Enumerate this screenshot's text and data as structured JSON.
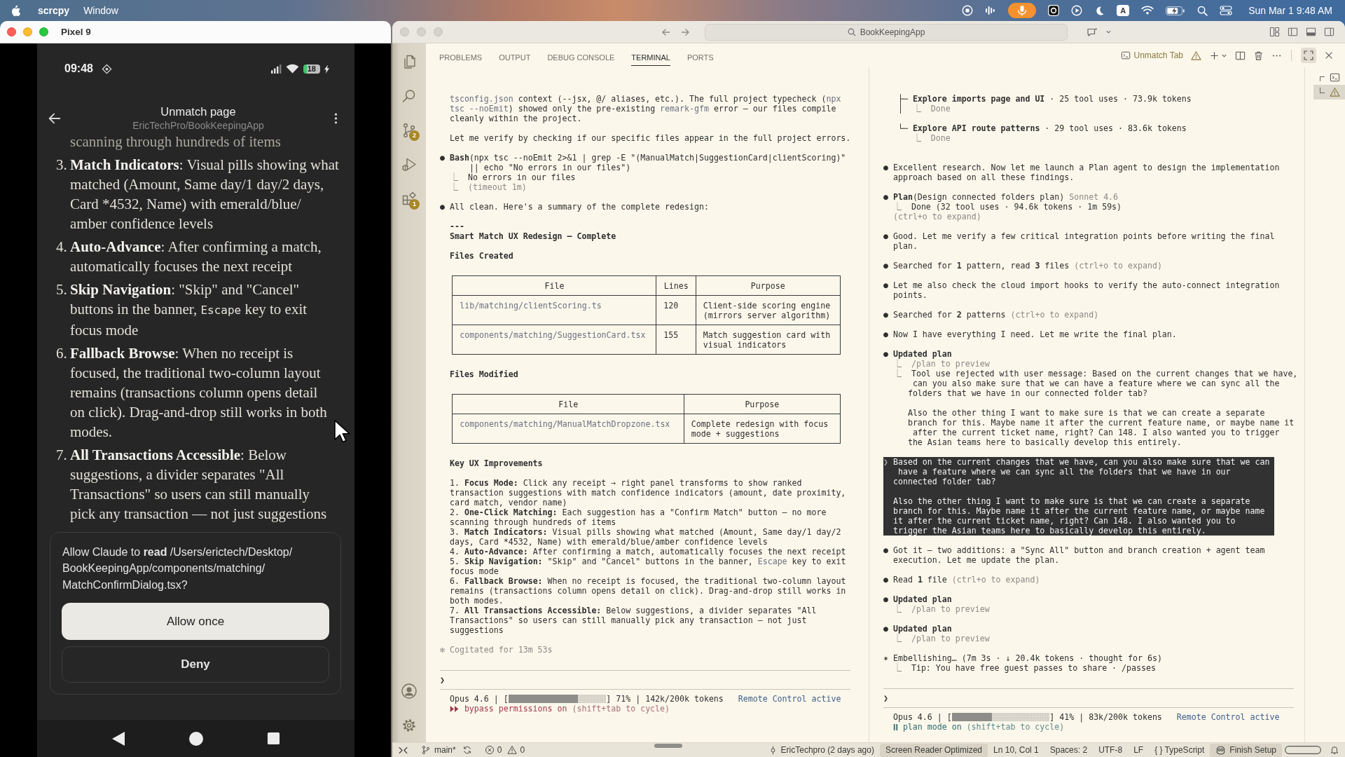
{
  "menu_bar": {
    "app_name": "scrcpy",
    "menus": [
      "Window"
    ],
    "input_source": "A",
    "clock": "Sun Mar 1 9:48 AM"
  },
  "phone_window": {
    "title": "Pixel 9",
    "status_bar": {
      "time": "09:48",
      "battery": "18"
    },
    "header": {
      "title": "Unmatch page",
      "subtitle": "EricTechPro/BookKeepingApp"
    },
    "cut_off_line": "scanning through hundreds of items",
    "items": [
      {
        "number": "3.",
        "parts": [
          {
            "text": "**Match Indicators**: Visual pills showing what\nmatched (Amount, Same day/1 day/2 days,\nCard ",
            "kind": "plain"
          },
          {
            "text": "*4532, Name) with emerald/blue/\namber confidence levels",
            "kind": "plain"
          }
        ]
      },
      {
        "number": "4.",
        "parts": [
          {
            "text": "**Auto-Advance**: After confirming a match,\nautomatically focuses the next receipt",
            "kind": "plain"
          }
        ]
      },
      {
        "number": "5.",
        "parts": [
          {
            "text": "**Skip Navigation**: \"Skip\" and \"Cancel\"\nbuttons in the banner, ",
            "kind": "plain"
          },
          {
            "text": "Escape",
            "kind": "code"
          },
          {
            "text": " key to exit\nfocus mode",
            "kind": "plain"
          }
        ]
      },
      {
        "number": "6.",
        "parts": [
          {
            "text": "**Fallback Browse**: When no receipt is\nfocused, the traditional two-column layout\nremains (transactions column opens detail\non click). Drag-and-drop still works in both\nmodes.",
            "kind": "plain"
          }
        ]
      },
      {
        "number": "7.",
        "parts": [
          {
            "text": "**All Transactions Accessible**: Below\nsuggestions, a divider separates \"All\nTransactions\" so users can still manually\npick any transaction — not just suggestions",
            "kind": "plain"
          }
        ]
      }
    ],
    "permission": {
      "text": "Allow Claude to **read** /Users/erictech/Desktop/\nBookKeepingApp/components/matching/\nMatchConfirmDialog.tsx?",
      "buttons": [
        {
          "label": "Allow once",
          "kind": "primary"
        },
        {
          "label": "Deny",
          "kind": "secondary"
        }
      ]
    }
  },
  "editor_window": {
    "search": "BookKeepingApp",
    "source_control_badge": "2",
    "extensions_badge": "1",
    "panel_tabs": [
      {
        "label": "PROBLEMS",
        "selected": false
      },
      {
        "label": "OUTPUT",
        "selected": false
      },
      {
        "label": "DEBUG CONSOLE",
        "selected": false
      },
      {
        "label": "TERMINAL",
        "selected": true
      },
      {
        "label": "PORTS",
        "selected": false
      }
    ],
    "terminal_name": "Unmatch Tab",
    "terminals": [
      {
        "sections": [
          {
            "items": [
              {
                "kind": "text",
                "parts": [
                  {
                    "text": "  tsconfig.json",
                    "kind": "code"
                  },
                  {
                    "text": " context (--jsx, @/ aliases, etc.). The full project typecheck (",
                    "kind": "plain"
                  },
                  {
                    "text": "npx\n  tsc --noEmit",
                    "kind": "code"
                  },
                  {
                    "text": ") showed only the pre-existing ",
                    "kind": "plain"
                  },
                  {
                    "text": "remark-gfm",
                    "kind": "code"
                  },
                  {
                    "text": " error — our files compile\n  cleanly within the project.",
                    "kind": "plain"
                  }
                ]
              }
            ]
          },
          {
            "items": [
              {
                "kind": "text",
                "parts": [
                  {
                    "text": "  Let me verify by checking if our specific files appear in the full project errors.",
                    "kind": "plain"
                  }
                ]
              }
            ]
          },
          {
            "items": [
              {
                "kind": "text",
                "parts": [
                  {
                    "text": "● **Bash**(npx tsc --noEmit 2>&1 | grep -E \"(ManualMatch|SuggestionCard|clientScoring)\"\n      || echo \"No errors in our files\")\n  ",
                    "kind": "plain"
                  },
                  {
                    "text": "⎿",
                    "kind": "dim"
                  },
                  {
                    "text": "  No errors in our files\n  ",
                    "kind": "plain"
                  },
                  {
                    "text": "⎿  (timeout 1m)",
                    "kind": "dim"
                  }
                ]
              }
            ]
          },
          {
            "items": [
              {
                "kind": "text",
                "parts": [
                  {
                    "text": "● All clean. Here's a summary of the complete redesign:",
                    "kind": "plain"
                  }
                ]
              }
            ]
          },
          {
            "items": [
              {
                "kind": "heading",
                "parts": [
                  {
                    "text": "  ---\n  Smart Match UX Redesign — Complete",
                    "kind": "plain"
                  }
                ]
              }
            ]
          },
          {
            "items": [
              {
                "kind": "heading",
                "parts": [
                  {
                    "text": "  Files Created",
                    "kind": "plain"
                  }
                ]
              }
            ]
          },
          {
            "items": [
              {
                "kind": "table",
                "columns": [
                  {
                    "label": "File",
                    "kind": "code"
                  },
                  {
                    "label": "Lines",
                    "kind": "plain"
                  },
                  {
                    "label": "Purpose",
                    "kind": "plain"
                  }
                ],
                "rows": [
                  [
                    "lib/matching/clientScoring.ts",
                    "120",
                    "Client-side scoring engine\n(mirrors server algorithm)"
                  ],
                  [
                    "components/matching/SuggestionCard.tsx",
                    "155",
                    "Match suggestion card with\nvisual indicators"
                  ]
                ]
              }
            ]
          },
          {
            "items": [
              {
                "kind": "heading",
                "parts": [
                  {
                    "text": "  Files Modified",
                    "kind": "plain"
                  }
                ]
              }
            ]
          },
          {
            "items": [
              {
                "kind": "table",
                "columns": [
                  {
                    "label": "File",
                    "kind": "code"
                  },
                  {
                    "label": "Purpose",
                    "kind": "plain"
                  }
                ],
                "rows": [
                  [
                    "components/matching/ManualMatchDropzone.tsx",
                    "Complete redesign with focus\nmode + suggestions"
                  ]
                ]
              }
            ]
          },
          {
            "items": [
              {
                "kind": "heading",
                "parts": [
                  {
                    "text": "  Key UX Improvements",
                    "kind": "plain"
                  }
                ]
              }
            ]
          },
          {
            "items": [
              {
                "kind": "list_item",
                "parts": [
                  {
                    "text": "  1. **Focus Mode:** Click any receipt → right panel transforms to show ranked\n  transaction suggestions with match confidence indicators (amount, date proximity,\n  card match, vendor name)",
                    "kind": "plain"
                  }
                ]
              },
              {
                "kind": "list_item",
                "parts": [
                  {
                    "text": "  2. **One-Click Matching:** Each suggestion has a \"Confirm Match\" button — no more\n  scanning through hundreds of items",
                    "kind": "plain"
                  }
                ]
              },
              {
                "kind": "list_item",
                "parts": [
                  {
                    "text": "  3. **Match Indicators:** Visual pills showing what matched (Amount, Same day/1 day/2\n  days, Card ",
                    "kind": "plain"
                  },
                  {
                    "text": "*4532, Name) with emerald/blue/amber confidence levels",
                    "kind": "plain"
                  }
                ]
              },
              {
                "kind": "list_item",
                "parts": [
                  {
                    "text": "  4. **Auto-Advance:** After confirming a match, automatically focuses the next receipt",
                    "kind": "plain"
                  }
                ]
              },
              {
                "kind": "list_item",
                "parts": [
                  {
                    "text": "  5. **Skip Navigation:** \"Skip\" and \"Cancel\" buttons in the banner, ",
                    "kind": "plain"
                  },
                  {
                    "text": "Escape",
                    "kind": "code"
                  },
                  {
                    "text": " key to exit\n  focus mode",
                    "kind": "plain"
                  }
                ]
              },
              {
                "kind": "list_item",
                "parts": [
                  {
                    "text": "  6. **Fallback Browse:** When no receipt is focused, the traditional two-column layout\n  remains (transactions column opens detail on click). Drag-and-drop still works in\n  both modes.",
                    "kind": "plain"
                  }
                ]
              },
              {
                "kind": "list_item",
                "parts": [
                  {
                    "text": "  7. **All Transactions Accessible:** Below suggestions, a divider separates \"All\n  Transactions\" so users can still manually pick any transaction — not just\n  suggestions",
                    "kind": "plain"
                  }
                ]
              }
            ]
          },
          {
            "items": [
              {
                "kind": "text",
                "parts": [
                  {
                    "text": "✻ Cogitated for 13m 53s",
                    "kind": "dim"
                  }
                ]
              }
            ]
          }
        ],
        "prompt": "❯",
        "status": {
          "model": "Opus 4.6 | [",
          "level": 0.71,
          "usage": "] 71% | 142k/200k tokens",
          "remote": "Remote Control active"
        },
        "mode": {
          "kind": "bypass",
          "label": "bypass permissions on",
          "hint": "(shift+tab to cycle)"
        }
      },
      {
        "sections": [
          {
            "items": [
              {
                "kind": "tree",
                "parts": [
                  {
                    "text": "   ├─ **Explore imports page and UI** · 25 tool uses · 73.9k tokens\n   │  ",
                    "kind": "plain"
                  },
                  {
                    "text": "⎿  Done",
                    "kind": "dim"
                  }
                ]
              }
            ]
          },
          {
            "items": [
              {
                "kind": "tree",
                "parts": [
                  {
                    "text": "   └─ **Explore API route patterns** · 29 tool uses · 83.6k tokens\n      ",
                    "kind": "plain"
                  },
                  {
                    "text": "⎿  Done",
                    "kind": "dim"
                  }
                ]
              }
            ]
          },
          {
            "items": [
              {
                "kind": "text",
                "parts": [
                  {
                    "text": "● Excellent research. Now let me launch a Plan agent to design the implementation\n  approach based on all these findings.",
                    "kind": "plain"
                  }
                ]
              }
            ]
          },
          {
            "items": [
              {
                "kind": "text",
                "parts": [
                  {
                    "text": "● **Plan**(Design connected folders plan) ",
                    "kind": "plain"
                  },
                  {
                    "text": "Sonnet 4.6\n  ⎿",
                    "kind": "dim"
                  },
                  {
                    "text": "  Done (32 tool uses · 94.6k tokens · 1m 59s)\n  ",
                    "kind": "plain"
                  },
                  {
                    "text": "(ctrl+o to expand)",
                    "kind": "dim"
                  }
                ]
              }
            ]
          },
          {
            "items": [
              {
                "kind": "text",
                "parts": [
                  {
                    "text": "● Good. Let me verify a few critical integration points before writing the final\n  plan.",
                    "kind": "plain"
                  }
                ]
              }
            ]
          },
          {
            "items": [
              {
                "kind": "text",
                "parts": [
                  {
                    "text": "● Searched for **1** pattern, read **3** files ",
                    "kind": "plain"
                  },
                  {
                    "text": "(ctrl+o to expand)",
                    "kind": "dim"
                  }
                ]
              }
            ]
          },
          {
            "items": [
              {
                "kind": "text",
                "parts": [
                  {
                    "text": "● Let me also check the cloud import hooks to verify the auto-connect integration\n  points.",
                    "kind": "plain"
                  }
                ]
              }
            ]
          },
          {
            "items": [
              {
                "kind": "text",
                "parts": [
                  {
                    "text": "● Searched for **2** patterns ",
                    "kind": "plain"
                  },
                  {
                    "text": "(ctrl+o to expand)",
                    "kind": "dim"
                  }
                ]
              }
            ]
          },
          {
            "items": [
              {
                "kind": "text",
                "parts": [
                  {
                    "text": "● Now I have everything I need. Let me write the final plan.",
                    "kind": "plain"
                  }
                ]
              }
            ]
          },
          {
            "items": [
              {
                "kind": "text",
                "parts": [
                  {
                    "text": "● **Updated plan**\n  ",
                    "kind": "plain"
                  },
                  {
                    "text": "⎿  /plan to preview\n  ⎿",
                    "kind": "dim"
                  },
                  {
                    "text": "  Tool use rejected with user message: Based on the current changes that we have,\n      can you also make sure that we can have a feature where we can sync all the\n     folders that we have in our connected folder tab?\n\n     Also the other thing I want to make sure is that we can create a separate\n     branch for this. Maybe name it after the current feature name, or maybe name it\n      after the current ticket name, right? Can 148. I also wanted you to trigger\n     the Asian teams here to basically develop this entirely.",
                    "kind": "plain"
                  }
                ]
              }
            ]
          },
          {
            "items": [
              {
                "kind": "highlight",
                "parts": [
                  {
                    "text": "❯",
                    "kind": "dim"
                  },
                  {
                    "text": " Based on the current changes that we have, can you also make sure that we can\n   have a feature where we can sync all the folders that we have in our\n  connected folder tab?\n\n  Also the other thing I want to make sure is that we can create a separate\n  branch for this. Maybe name it after the current feature name, or maybe name\n  it after the current ticket name, right? Can 148. I also wanted you to\n  trigger the Asian teams here to basically develop this entirely.",
                    "kind": "plain"
                  }
                ]
              }
            ]
          },
          {
            "items": [
              {
                "kind": "text",
                "parts": [
                  {
                    "text": "● Got it — two additions: a \"Sync All\" button and branch creation + agent team\n  execution. Let me update the plan.",
                    "kind": "plain"
                  }
                ]
              }
            ]
          },
          {
            "items": [
              {
                "kind": "text",
                "parts": [
                  {
                    "text": "● Read **1** file ",
                    "kind": "plain"
                  },
                  {
                    "text": "(ctrl+o to expand)",
                    "kind": "dim"
                  }
                ]
              }
            ]
          },
          {
            "items": [
              {
                "kind": "text",
                "parts": [
                  {
                    "text": "● **Updated plan**\n  ",
                    "kind": "plain"
                  },
                  {
                    "text": "⎿  /plan to preview",
                    "kind": "dim"
                  }
                ]
              }
            ]
          },
          {
            "items": [
              {
                "kind": "text",
                "parts": [
                  {
                    "text": "● **Updated plan**\n  ",
                    "kind": "plain"
                  },
                  {
                    "text": "⎿  /plan to preview",
                    "kind": "dim"
                  }
                ]
              }
            ]
          },
          {
            "items": [
              {
                "kind": "text",
                "parts": [
                  {
                    "text": "✶ Embellishing… (7m 3s · ↓ 20.4k tokens · thought for 6s)\n  ",
                    "kind": "plain"
                  },
                  {
                    "text": "⎿",
                    "kind": "dim"
                  },
                  {
                    "text": "  Tip: You have free guest passes to share · /passes",
                    "kind": "plain"
                  }
                ]
              }
            ]
          }
        ],
        "prompt": "❯",
        "status": {
          "model": "Opus 4.6 | [",
          "level": 0.41,
          "usage": "] 41% | 83k/200k tokens",
          "remote": "Remote Control active"
        },
        "mode": {
          "kind": "plan",
          "label": "plan mode on",
          "hint": "(shift+tab to cycle)"
        }
      }
    ],
    "terminal_list": [
      {
        "kind": "terminal",
        "selected": false
      },
      {
        "kind": "warning",
        "selected": true
      }
    ],
    "status_bar": {
      "branch": "main*",
      "problems": [
        {
          "kind": "error",
          "count": "0"
        },
        {
          "kind": "warning",
          "count": "0"
        }
      ],
      "blame": "EricTechpro (2 days ago)",
      "items": [
        {
          "label": "Screen Reader Optimized",
          "highlighted": true
        },
        {
          "label": "Ln 10, Col 1",
          "highlighted": false
        },
        {
          "label": "Spaces: 2",
          "highlighted": false
        },
        {
          "label": "UTF-8",
          "highlighted": false
        },
        {
          "label": "LF",
          "highlighted": false
        }
      ],
      "language": {
        "icon": "{ }",
        "label": "TypeScript"
      },
      "setup": "Finish Setup"
    }
  }
}
